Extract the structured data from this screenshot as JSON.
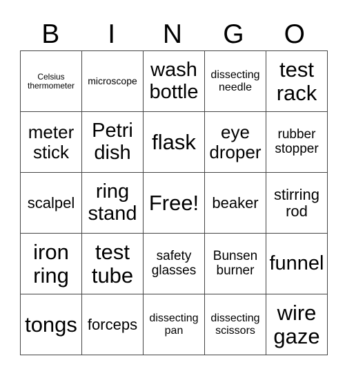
{
  "header": {
    "letters": [
      "B",
      "I",
      "N",
      "G",
      "O"
    ]
  },
  "grid": {
    "rows": [
      [
        {
          "text": "Celsius thermometer",
          "size": "s1"
        },
        {
          "text": "microscope",
          "size": "s2"
        },
        {
          "text": "wash bottle",
          "size": "s7"
        },
        {
          "text": "dissecting needle",
          "size": "s3"
        },
        {
          "text": "test rack",
          "size": "s8"
        }
      ],
      [
        {
          "text": "meter stick",
          "size": "s6"
        },
        {
          "text": "Petri dish",
          "size": "s7"
        },
        {
          "text": "flask",
          "size": "s8"
        },
        {
          "text": "eye droper",
          "size": "s6"
        },
        {
          "text": "rubber stopper",
          "size": "s4"
        }
      ],
      [
        {
          "text": "scalpel",
          "size": "s5"
        },
        {
          "text": "ring stand",
          "size": "s7"
        },
        {
          "text": "Free!",
          "size": "s8"
        },
        {
          "text": "beaker",
          "size": "s5"
        },
        {
          "text": "stirring rod",
          "size": "s5"
        }
      ],
      [
        {
          "text": "iron ring",
          "size": "s8"
        },
        {
          "text": "test tube",
          "size": "s8"
        },
        {
          "text": "safety glasses",
          "size": "s4"
        },
        {
          "text": "Bunsen burner",
          "size": "s4"
        },
        {
          "text": "funnel",
          "size": "s7"
        }
      ],
      [
        {
          "text": "tongs",
          "size": "s8"
        },
        {
          "text": "forceps",
          "size": "s5"
        },
        {
          "text": "dissecting pan",
          "size": "s3"
        },
        {
          "text": "dissecting scissors",
          "size": "s3"
        },
        {
          "text": "wire gaze",
          "size": "s8"
        }
      ]
    ]
  }
}
